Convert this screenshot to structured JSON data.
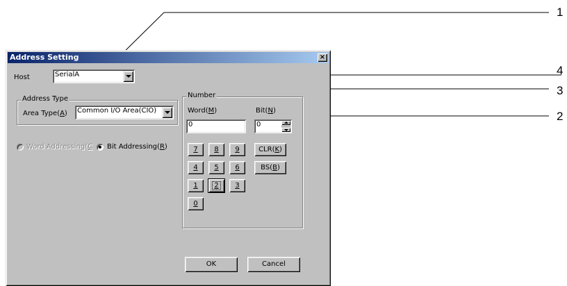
{
  "callouts": [
    "1",
    "4",
    "3",
    "2"
  ],
  "dialog": {
    "title": "Address Setting",
    "close": "×",
    "host_label": "Host",
    "host_value": "SerialA",
    "address_type_legend": "Address Type",
    "area_type_label": "Area Type(",
    "area_type_key": "A",
    "area_type_close": ")",
    "area_type_value": "Common I/O Area(CIO)",
    "word_addressing_label": "Word Addressing(",
    "word_addressing_key": "C",
    "bit_addressing_label": "Bit Addressing(",
    "bit_addressing_key": "R",
    "bit_addressing_close": ")",
    "number_legend": "Number",
    "word_label": "Word(",
    "word_key": "M",
    "word_close": ")",
    "bit_label": "Bit(",
    "bit_key": "N",
    "bit_close": ")",
    "word_value": "0",
    "bit_value": "0",
    "keys": [
      "7",
      "8",
      "9",
      "4",
      "5",
      "6",
      "1",
      "2",
      "3",
      "0"
    ],
    "clr_label": "CLR(",
    "clr_key": "K",
    "clr_close": ")",
    "bs_label": "BS(",
    "bs_key": "B",
    "bs_close": ")",
    "ok_label": "OK",
    "cancel_label": "Cancel"
  }
}
